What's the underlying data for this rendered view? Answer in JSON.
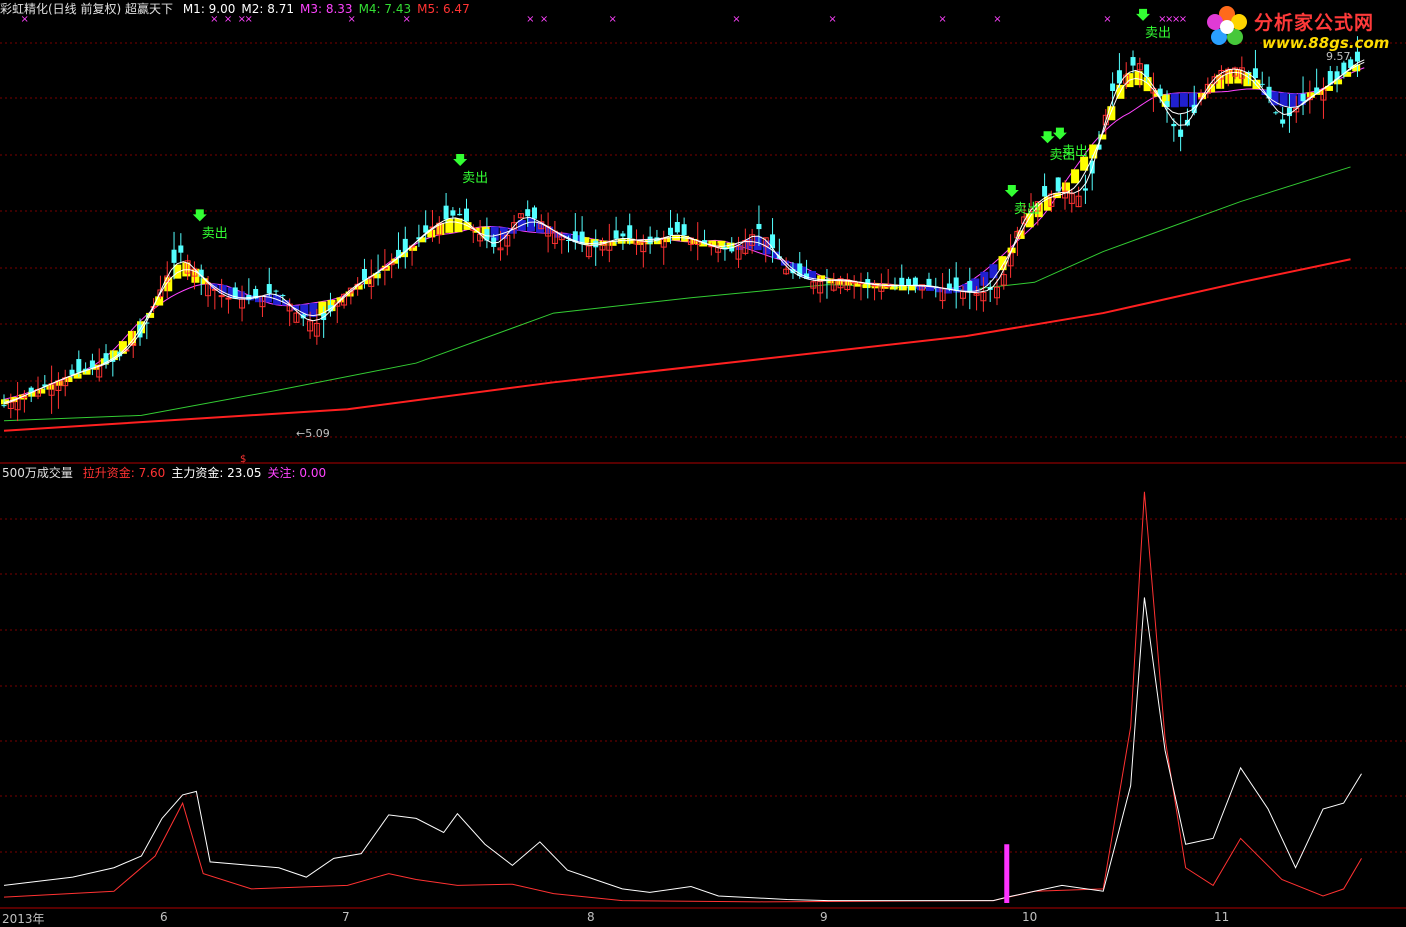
{
  "header": {
    "title": "彩虹精化(日线 前复权) 超赢天下",
    "ma": [
      {
        "label": "M1: 9.00",
        "color": "#ffffff"
      },
      {
        "label": "M2: 8.71",
        "color": "#ffffff"
      },
      {
        "label": "M3: 8.33",
        "color": "#ff44ff"
      },
      {
        "label": "M4: 7.43",
        "color": "#33dd33"
      },
      {
        "label": "M5: 6.47",
        "color": "#ff3333"
      }
    ]
  },
  "sub_header": {
    "title": "500万成交量",
    "items": [
      {
        "label": "拉升资金: 7.60",
        "color": "#ff3333"
      },
      {
        "label": "主力资金: 23.05",
        "color": "#ffffff"
      },
      {
        "label": "关注: 0.00",
        "color": "#ff44ff"
      }
    ]
  },
  "logo": {
    "brand": "分析家公式网",
    "url": "www.88gs.com"
  },
  "x_axis": [
    "2013年",
    "6",
    "7",
    "8",
    "9",
    "10",
    "11"
  ],
  "colors": {
    "up": "#ff3232",
    "down": "#54ffff",
    "grid": "#7a0000",
    "ma_white": "#ffffff",
    "ma_magenta": "#ff44ff",
    "ma_green": "#33cc33",
    "ma_red": "#ff2020",
    "yellow": "#ffff00",
    "blue": "#2020d0",
    "sell": "#33ff33"
  },
  "chart_data": {
    "type": "candlestick",
    "price_range": [
      4.6,
      9.8
    ],
    "max_label": "9.57",
    "min_label": "←5.09",
    "sell_label": "卖出",
    "sell_signals": [
      0.1425,
      0.332,
      0.7335,
      0.7595,
      0.7685,
      0.829
    ],
    "close_points": [
      [
        0.0,
        5.05
      ],
      [
        0.02,
        5.22
      ],
      [
        0.05,
        5.45
      ],
      [
        0.08,
        5.62
      ],
      [
        0.1,
        5.95
      ],
      [
        0.115,
        6.6
      ],
      [
        0.128,
        7.05
      ],
      [
        0.142,
        6.75
      ],
      [
        0.16,
        6.45
      ],
      [
        0.18,
        6.42
      ],
      [
        0.2,
        6.55
      ],
      [
        0.215,
        6.2
      ],
      [
        0.23,
        6.1
      ],
      [
        0.25,
        6.55
      ],
      [
        0.27,
        6.75
      ],
      [
        0.29,
        7.0
      ],
      [
        0.31,
        7.35
      ],
      [
        0.33,
        7.55
      ],
      [
        0.345,
        7.3
      ],
      [
        0.36,
        7.05
      ],
      [
        0.375,
        7.55
      ],
      [
        0.39,
        7.45
      ],
      [
        0.41,
        7.2
      ],
      [
        0.43,
        7.1
      ],
      [
        0.45,
        7.25
      ],
      [
        0.47,
        7.15
      ],
      [
        0.49,
        7.3
      ],
      [
        0.51,
        7.15
      ],
      [
        0.53,
        7.05
      ],
      [
        0.55,
        7.35
      ],
      [
        0.57,
        6.8
      ],
      [
        0.59,
        6.65
      ],
      [
        0.61,
        6.7
      ],
      [
        0.63,
        6.62
      ],
      [
        0.65,
        6.6
      ],
      [
        0.67,
        6.62
      ],
      [
        0.69,
        6.55
      ],
      [
        0.71,
        6.5
      ],
      [
        0.725,
        6.6
      ],
      [
        0.74,
        7.45
      ],
      [
        0.755,
        7.75
      ],
      [
        0.77,
        7.85
      ],
      [
        0.785,
        7.75
      ],
      [
        0.795,
        8.2
      ],
      [
        0.805,
        9.1
      ],
      [
        0.815,
        9.3
      ],
      [
        0.825,
        9.55
      ],
      [
        0.835,
        9.2
      ],
      [
        0.845,
        9.0
      ],
      [
        0.855,
        8.5
      ],
      [
        0.865,
        8.8
      ],
      [
        0.875,
        9.2
      ],
      [
        0.885,
        9.4
      ],
      [
        0.9,
        9.45
      ],
      [
        0.915,
        9.25
      ],
      [
        0.93,
        8.7
      ],
      [
        0.945,
        9.0
      ],
      [
        0.96,
        9.15
      ],
      [
        0.975,
        9.35
      ],
      [
        0.988,
        9.57
      ]
    ],
    "m5_points": [
      [
        0.0,
        4.72
      ],
      [
        0.25,
        5.0
      ],
      [
        0.4,
        5.35
      ],
      [
        0.55,
        5.65
      ],
      [
        0.7,
        5.95
      ],
      [
        0.8,
        6.25
      ],
      [
        0.9,
        6.65
      ],
      [
        0.98,
        6.95
      ]
    ],
    "m4_points": [
      [
        0.0,
        4.85
      ],
      [
        0.1,
        4.92
      ],
      [
        0.2,
        5.25
      ],
      [
        0.3,
        5.6
      ],
      [
        0.4,
        6.25
      ],
      [
        0.5,
        6.45
      ],
      [
        0.6,
        6.62
      ],
      [
        0.7,
        6.55
      ],
      [
        0.75,
        6.65
      ],
      [
        0.8,
        7.05
      ],
      [
        0.9,
        7.7
      ],
      [
        0.98,
        8.15
      ]
    ],
    "volume_range": [
      0,
      36
    ],
    "volume_white": [
      [
        0.0,
        1.5
      ],
      [
        0.05,
        2.2
      ],
      [
        0.08,
        3.0
      ],
      [
        0.1,
        4.0
      ],
      [
        0.115,
        7.2
      ],
      [
        0.13,
        9.2
      ],
      [
        0.14,
        9.5
      ],
      [
        0.15,
        3.5
      ],
      [
        0.2,
        3.0
      ],
      [
        0.22,
        2.2
      ],
      [
        0.24,
        3.8
      ],
      [
        0.26,
        4.2
      ],
      [
        0.28,
        7.5
      ],
      [
        0.3,
        7.2
      ],
      [
        0.32,
        6.0
      ],
      [
        0.33,
        7.6
      ],
      [
        0.35,
        5.0
      ],
      [
        0.37,
        3.2
      ],
      [
        0.39,
        5.2
      ],
      [
        0.41,
        2.8
      ],
      [
        0.43,
        2.0
      ],
      [
        0.45,
        1.2
      ],
      [
        0.47,
        0.9
      ],
      [
        0.5,
        1.4
      ],
      [
        0.52,
        0.6
      ],
      [
        0.57,
        0.3
      ],
      [
        0.6,
        0.2
      ],
      [
        0.72,
        0.2
      ],
      [
        0.73,
        0.5
      ],
      [
        0.77,
        1.5
      ],
      [
        0.8,
        1.0
      ],
      [
        0.82,
        10.0
      ],
      [
        0.83,
        26.0
      ],
      [
        0.845,
        13.0
      ],
      [
        0.86,
        5.0
      ],
      [
        0.88,
        5.5
      ],
      [
        0.9,
        11.5
      ],
      [
        0.92,
        8.0
      ],
      [
        0.94,
        3.0
      ],
      [
        0.96,
        8.0
      ],
      [
        0.975,
        8.5
      ],
      [
        0.988,
        11.0
      ]
    ],
    "volume_red": [
      [
        0.0,
        0.5
      ],
      [
        0.08,
        1.0
      ],
      [
        0.11,
        4.0
      ],
      [
        0.13,
        8.5
      ],
      [
        0.145,
        2.5
      ],
      [
        0.18,
        1.2
      ],
      [
        0.25,
        1.5
      ],
      [
        0.28,
        2.5
      ],
      [
        0.3,
        2.0
      ],
      [
        0.33,
        1.5
      ],
      [
        0.37,
        1.6
      ],
      [
        0.4,
        0.8
      ],
      [
        0.45,
        0.2
      ],
      [
        0.55,
        0.1
      ],
      [
        0.72,
        0.2
      ],
      [
        0.75,
        1.0
      ],
      [
        0.8,
        1.2
      ],
      [
        0.82,
        15.0
      ],
      [
        0.83,
        35.0
      ],
      [
        0.845,
        14.0
      ],
      [
        0.86,
        3.0
      ],
      [
        0.88,
        1.5
      ],
      [
        0.9,
        5.5
      ],
      [
        0.93,
        2.0
      ],
      [
        0.96,
        0.6
      ],
      [
        0.975,
        1.2
      ],
      [
        0.988,
        3.8
      ]
    ],
    "focus_bar": {
      "x": 0.728,
      "value": 5.0
    }
  }
}
